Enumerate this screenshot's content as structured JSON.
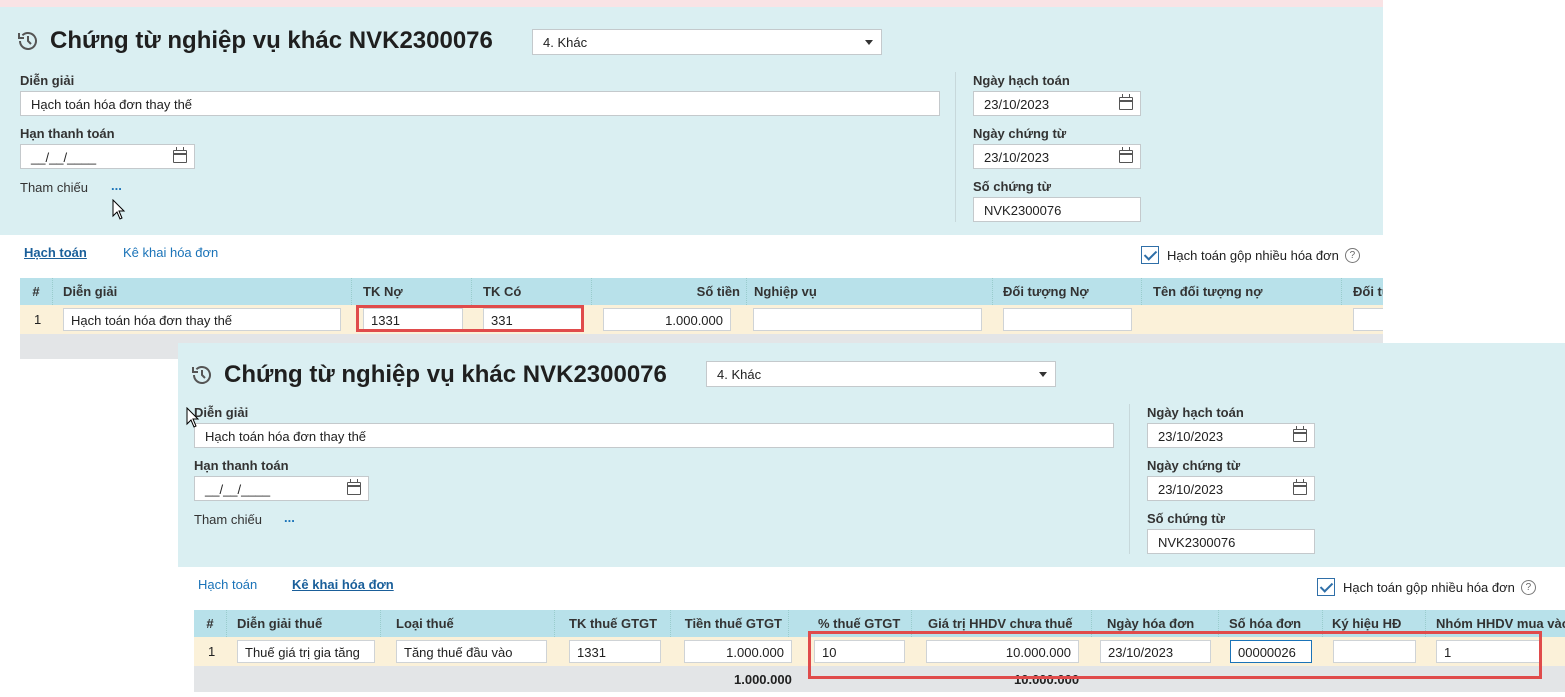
{
  "top": {
    "title": "Chứng từ nghiệp vụ khác NVK2300076",
    "type_select": "4. Khác",
    "labels": {
      "dien_giai": "Diễn giải",
      "han_thanh_toan": "Hạn thanh toán",
      "tham_chieu": "Tham chiếu",
      "ngay_hach_toan": "Ngày hạch toán",
      "ngay_chung_tu": "Ngày chứng từ",
      "so_chung_tu": "Số chứng từ"
    },
    "values": {
      "dien_giai": "Hạch toán hóa đơn thay thế",
      "han_thanh_toan": "__/__/____",
      "ngay_hach_toan": "23/10/2023",
      "ngay_chung_tu": "23/10/2023",
      "so_chung_tu": "NVK2300076",
      "dots": "..."
    },
    "tabs": [
      "Hạch toán",
      "Kê khai hóa đơn"
    ],
    "checkbox_label": "Hạch toán gộp nhiều hóa đơn",
    "help": "?",
    "grid": {
      "columns": [
        "#",
        "Diễn giải",
        "TK Nợ",
        "TK Có",
        "Số tiền",
        "Nghiệp vụ",
        "Đối tượng Nợ",
        "Tên đối tượng nợ",
        "Đối tượng Có"
      ],
      "row": {
        "num": "1",
        "dien_giai": "Hạch toán hóa đơn thay thế",
        "tk_no": "1331",
        "tk_co": "331",
        "so_tien": "1.000.000"
      }
    }
  },
  "bottom": {
    "title": "Chứng từ nghiệp vụ khác NVK2300076",
    "type_select": "4. Khác",
    "labels": {
      "dien_giai": "Diễn giải",
      "han_thanh_toan": "Hạn thanh toán",
      "tham_chieu": "Tham chiếu",
      "ngay_hach_toan": "Ngày hạch toán",
      "ngay_chung_tu": "Ngày chứng từ",
      "so_chung_tu": "Số chứng từ"
    },
    "values": {
      "dien_giai": "Hạch toán hóa đơn thay thế",
      "han_thanh_toan": "__/__/____",
      "ngay_hach_toan": "23/10/2023",
      "ngay_chung_tu": "23/10/2023",
      "so_chung_tu": "NVK2300076",
      "dots": "..."
    },
    "tabs": [
      "Hạch toán",
      "Kê khai hóa đơn"
    ],
    "checkbox_label": "Hạch toán gộp nhiều hóa đơn",
    "help": "?",
    "grid": {
      "columns": [
        "#",
        "Diễn giải thuế",
        "Loại thuế",
        "TK thuế GTGT",
        "Tiền thuế GTGT",
        "% thuế GTGT",
        "Giá trị HHDV chưa thuế",
        "Ngày hóa đơn",
        "Số hóa đơn",
        "Ký hiệu HĐ",
        "Nhóm HHDV mua vào"
      ],
      "row": {
        "num": "1",
        "dien_giai_thue": "Thuế giá trị gia tăng",
        "loai_thue": "Tăng thuế đầu vào",
        "tk_thue": "1331",
        "tien_thue": "1.000.000",
        "phan_tram": "10",
        "gia_tri": "10.000.000",
        "ngay_hd": "23/10/2023",
        "so_hd": "00000026",
        "ky_hieu": "",
        "nhom": "1"
      },
      "totals": {
        "tien_thue": "1.000.000",
        "gia_tri": "10.000.000"
      }
    }
  }
}
